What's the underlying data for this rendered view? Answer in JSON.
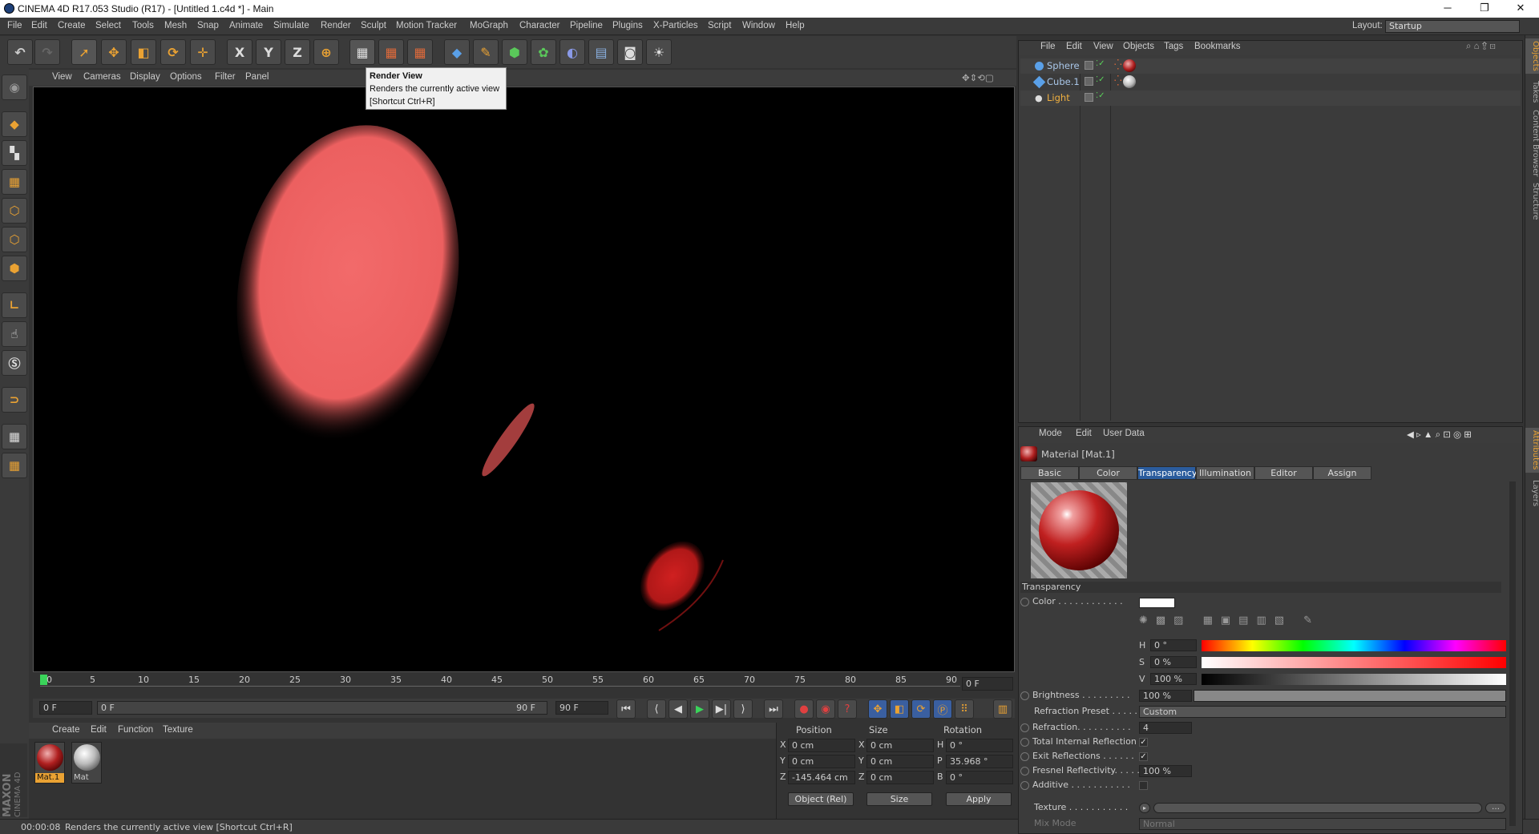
{
  "window": {
    "title": "CINEMA 4D R17.053 Studio (R17) - [Untitled 1.c4d *] - Main",
    "minimize": "─",
    "maximize": "❐",
    "close": "✕"
  },
  "menubar": {
    "items": [
      "File",
      "Edit",
      "Create",
      "Select",
      "Tools",
      "Mesh",
      "Snap",
      "Animate",
      "Simulate",
      "Render",
      "Sculpt",
      "Motion Tracker",
      "MoGraph",
      "Character",
      "Pipeline",
      "Plugins",
      "X-Particles",
      "Script",
      "Window",
      "Help"
    ],
    "layout_label": "Layout:",
    "layout_value": "Startup"
  },
  "toolbar": {
    "axis_x": "X",
    "axis_y": "Y",
    "axis_z": "Z"
  },
  "tooltip": {
    "title": "Render View",
    "desc": "Renders the currently active view",
    "shortcut": "[Shortcut Ctrl+R]"
  },
  "viewport": {
    "menu": [
      "View",
      "Cameras",
      "Display",
      "Options",
      "Filter",
      "Panel"
    ]
  },
  "timeline": {
    "ticks": [
      "0",
      "5",
      "10",
      "15",
      "20",
      "25",
      "30",
      "35",
      "40",
      "45",
      "50",
      "55",
      "60",
      "65",
      "70",
      "75",
      "80",
      "85",
      "90"
    ],
    "current_frame": "0 F",
    "start": "0 F",
    "range_start": "0 F",
    "range_end": "90 F",
    "end": "90 F"
  },
  "material_manager": {
    "menu": [
      "Create",
      "Edit",
      "Function",
      "Texture"
    ],
    "materials": [
      {
        "name": "Mat.1",
        "selected": true
      },
      {
        "name": "Mat",
        "selected": false
      }
    ]
  },
  "coordinates": {
    "headers": [
      "Position",
      "Size",
      "Rotation"
    ],
    "rows": [
      {
        "axis": "X",
        "pos": "0 cm",
        "saxis": "X",
        "size": "0 cm",
        "raxis": "H",
        "rot": "0 °"
      },
      {
        "axis": "Y",
        "pos": "0 cm",
        "saxis": "Y",
        "size": "0 cm",
        "raxis": "P",
        "rot": "35.968 °"
      },
      {
        "axis": "Z",
        "pos": "-145.464 cm",
        "saxis": "Z",
        "size": "0 cm",
        "raxis": "B",
        "rot": "0 °"
      }
    ],
    "mode": "Object (Rel)",
    "size_mode": "Size",
    "apply": "Apply"
  },
  "status": {
    "time": "00:00:08",
    "text": "Renders the currently active view [Shortcut Ctrl+R]"
  },
  "object_manager": {
    "menu": [
      "File",
      "Edit",
      "View",
      "Objects",
      "Tags",
      "Bookmarks"
    ],
    "objects": [
      {
        "name": "Sphere",
        "color": "#a9c6e8"
      },
      {
        "name": "Cube.1",
        "color": "#a9c6e8"
      },
      {
        "name": "Light",
        "color": "#f0b040"
      }
    ]
  },
  "attribute_manager": {
    "menu": [
      "Mode",
      "Edit",
      "User Data"
    ],
    "title": "Material [Mat.1]",
    "tabs": [
      "Basic",
      "Color",
      "Transparency",
      "Illumination",
      "Editor",
      "Assign"
    ],
    "active_tab": "Transparency",
    "section": "Transparency",
    "color_label": "Color . . . . . . . . . . . .",
    "h_label": "H",
    "h_value": "0 °",
    "s_label": "S",
    "s_value": "0 %",
    "v_label": "V",
    "v_value": "100 %",
    "brightness_label": "Brightness . . . . . . . . .",
    "brightness_value": "100 %",
    "refraction_preset_label": "Refraction Preset . . . . . .",
    "refraction_preset_value": "Custom",
    "refraction_label": "Refraction. . . . . . . . . .",
    "refraction_value": "4",
    "tir_label": "Total Internal Reflection",
    "exit_label": "Exit Reflections . . . . . .",
    "fresnel_label": "Fresnel Reflectivity. . . . .",
    "fresnel_value": "100 %",
    "additive_label": "Additive . . . . . . . . . . .",
    "texture_label": "Texture . . . . . . . . . . .",
    "mixmode_label": "Mix Mode",
    "mixmode_value": "Normal"
  },
  "right_tabs": [
    "Objects",
    "Takes",
    "Content Browser",
    "Structure",
    "Attributes",
    "Layers"
  ],
  "branding": {
    "line1": "MAXON",
    "line2": "CINEMA 4D"
  }
}
